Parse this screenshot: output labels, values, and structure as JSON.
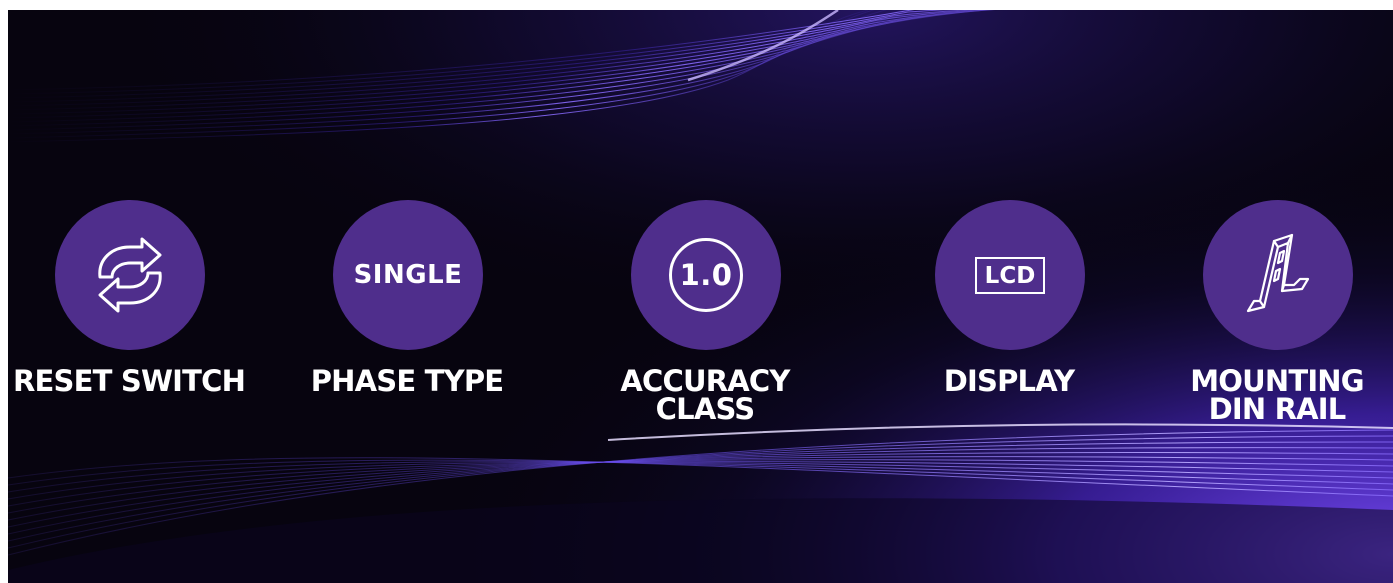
{
  "colors": {
    "background": "#07040f",
    "circle": "#4f2e8c",
    "wave_accent": "#7b4dff",
    "text": "#ffffff"
  },
  "features": [
    {
      "icon": "refresh-arrows-icon",
      "label": "RESET SWITCH"
    },
    {
      "icon": "text-badge",
      "badge": "SINGLE",
      "label": "PHASE TYPE"
    },
    {
      "icon": "circled-value",
      "badge": "1.0",
      "label": "ACCURACY CLASS"
    },
    {
      "icon": "lcd-screen-icon",
      "badge": "LCD",
      "label": "DISPLAY"
    },
    {
      "icon": "din-rail-icon",
      "label": "MOUNTING\nDIN RAIL"
    }
  ]
}
